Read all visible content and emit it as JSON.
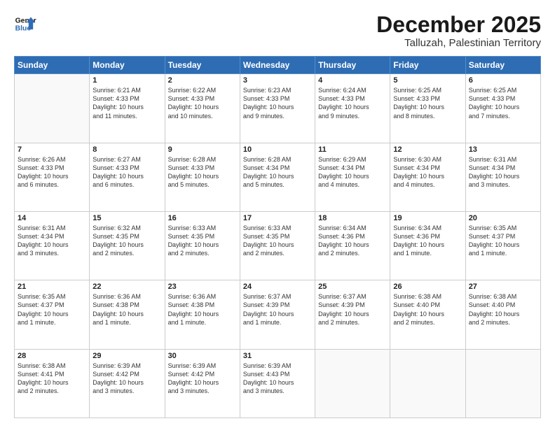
{
  "logo": {
    "line1": "General",
    "line2": "Blue"
  },
  "title": "December 2025",
  "subtitle": "Talluzah, Palestinian Territory",
  "header": {
    "days": [
      "Sunday",
      "Monday",
      "Tuesday",
      "Wednesday",
      "Thursday",
      "Friday",
      "Saturday"
    ]
  },
  "weeks": [
    [
      {
        "day": "",
        "content": ""
      },
      {
        "day": "1",
        "content": "Sunrise: 6:21 AM\nSunset: 4:33 PM\nDaylight: 10 hours\nand 11 minutes."
      },
      {
        "day": "2",
        "content": "Sunrise: 6:22 AM\nSunset: 4:33 PM\nDaylight: 10 hours\nand 10 minutes."
      },
      {
        "day": "3",
        "content": "Sunrise: 6:23 AM\nSunset: 4:33 PM\nDaylight: 10 hours\nand 9 minutes."
      },
      {
        "day": "4",
        "content": "Sunrise: 6:24 AM\nSunset: 4:33 PM\nDaylight: 10 hours\nand 9 minutes."
      },
      {
        "day": "5",
        "content": "Sunrise: 6:25 AM\nSunset: 4:33 PM\nDaylight: 10 hours\nand 8 minutes."
      },
      {
        "day": "6",
        "content": "Sunrise: 6:25 AM\nSunset: 4:33 PM\nDaylight: 10 hours\nand 7 minutes."
      }
    ],
    [
      {
        "day": "7",
        "content": "Sunrise: 6:26 AM\nSunset: 4:33 PM\nDaylight: 10 hours\nand 6 minutes."
      },
      {
        "day": "8",
        "content": "Sunrise: 6:27 AM\nSunset: 4:33 PM\nDaylight: 10 hours\nand 6 minutes."
      },
      {
        "day": "9",
        "content": "Sunrise: 6:28 AM\nSunset: 4:33 PM\nDaylight: 10 hours\nand 5 minutes."
      },
      {
        "day": "10",
        "content": "Sunrise: 6:28 AM\nSunset: 4:34 PM\nDaylight: 10 hours\nand 5 minutes."
      },
      {
        "day": "11",
        "content": "Sunrise: 6:29 AM\nSunset: 4:34 PM\nDaylight: 10 hours\nand 4 minutes."
      },
      {
        "day": "12",
        "content": "Sunrise: 6:30 AM\nSunset: 4:34 PM\nDaylight: 10 hours\nand 4 minutes."
      },
      {
        "day": "13",
        "content": "Sunrise: 6:31 AM\nSunset: 4:34 PM\nDaylight: 10 hours\nand 3 minutes."
      }
    ],
    [
      {
        "day": "14",
        "content": "Sunrise: 6:31 AM\nSunset: 4:34 PM\nDaylight: 10 hours\nand 3 minutes."
      },
      {
        "day": "15",
        "content": "Sunrise: 6:32 AM\nSunset: 4:35 PM\nDaylight: 10 hours\nand 2 minutes."
      },
      {
        "day": "16",
        "content": "Sunrise: 6:33 AM\nSunset: 4:35 PM\nDaylight: 10 hours\nand 2 minutes."
      },
      {
        "day": "17",
        "content": "Sunrise: 6:33 AM\nSunset: 4:35 PM\nDaylight: 10 hours\nand 2 minutes."
      },
      {
        "day": "18",
        "content": "Sunrise: 6:34 AM\nSunset: 4:36 PM\nDaylight: 10 hours\nand 2 minutes."
      },
      {
        "day": "19",
        "content": "Sunrise: 6:34 AM\nSunset: 4:36 PM\nDaylight: 10 hours\nand 1 minute."
      },
      {
        "day": "20",
        "content": "Sunrise: 6:35 AM\nSunset: 4:37 PM\nDaylight: 10 hours\nand 1 minute."
      }
    ],
    [
      {
        "day": "21",
        "content": "Sunrise: 6:35 AM\nSunset: 4:37 PM\nDaylight: 10 hours\nand 1 minute."
      },
      {
        "day": "22",
        "content": "Sunrise: 6:36 AM\nSunset: 4:38 PM\nDaylight: 10 hours\nand 1 minute."
      },
      {
        "day": "23",
        "content": "Sunrise: 6:36 AM\nSunset: 4:38 PM\nDaylight: 10 hours\nand 1 minute."
      },
      {
        "day": "24",
        "content": "Sunrise: 6:37 AM\nSunset: 4:39 PM\nDaylight: 10 hours\nand 1 minute."
      },
      {
        "day": "25",
        "content": "Sunrise: 6:37 AM\nSunset: 4:39 PM\nDaylight: 10 hours\nand 2 minutes."
      },
      {
        "day": "26",
        "content": "Sunrise: 6:38 AM\nSunset: 4:40 PM\nDaylight: 10 hours\nand 2 minutes."
      },
      {
        "day": "27",
        "content": "Sunrise: 6:38 AM\nSunset: 4:40 PM\nDaylight: 10 hours\nand 2 minutes."
      }
    ],
    [
      {
        "day": "28",
        "content": "Sunrise: 6:38 AM\nSunset: 4:41 PM\nDaylight: 10 hours\nand 2 minutes."
      },
      {
        "day": "29",
        "content": "Sunrise: 6:39 AM\nSunset: 4:42 PM\nDaylight: 10 hours\nand 3 minutes."
      },
      {
        "day": "30",
        "content": "Sunrise: 6:39 AM\nSunset: 4:42 PM\nDaylight: 10 hours\nand 3 minutes."
      },
      {
        "day": "31",
        "content": "Sunrise: 6:39 AM\nSunset: 4:43 PM\nDaylight: 10 hours\nand 3 minutes."
      },
      {
        "day": "",
        "content": ""
      },
      {
        "day": "",
        "content": ""
      },
      {
        "day": "",
        "content": ""
      }
    ]
  ]
}
